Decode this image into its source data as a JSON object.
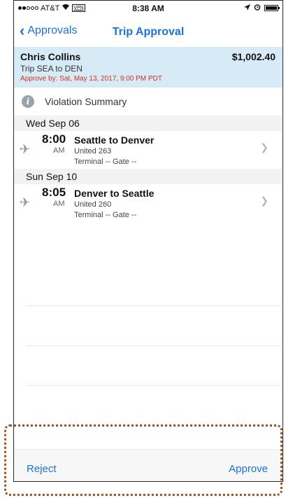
{
  "status_bar": {
    "carrier": "AT&T",
    "vpn": "VPN",
    "time": "8:38 AM",
    "icons": [
      "signal-icon",
      "wifi-icon",
      "location-icon",
      "alarm-icon",
      "battery-icon"
    ]
  },
  "nav": {
    "back_label": "Approvals",
    "title": "Trip Approval"
  },
  "summary": {
    "traveler": "Chris Collins",
    "amount": "$1,002.40",
    "trip": "Trip SEA to DEN",
    "approve_by": "Approve by: Sat, May 13, 2017, 9:00 PM PDT"
  },
  "violation": {
    "label": "Violation Summary"
  },
  "days": [
    {
      "date": "Wed Sep 06",
      "flight": {
        "time": "8:00",
        "ampm": "AM",
        "route": "Seattle to Denver",
        "airline": "United 263",
        "terminal": "Terminal -- Gate --"
      }
    },
    {
      "date": "Sun Sep 10",
      "flight": {
        "time": "8:05",
        "ampm": "AM",
        "route": "Denver to Seattle",
        "airline": "United 260",
        "terminal": "Terminal -- Gate --"
      }
    }
  ],
  "footer": {
    "reject_label": "Reject",
    "approve_label": "Approve"
  },
  "colors": {
    "accent": "#1a73d6",
    "summary_bg": "#d7ebf7",
    "deadline": "#d0301f",
    "highlight": "#a0521c"
  }
}
